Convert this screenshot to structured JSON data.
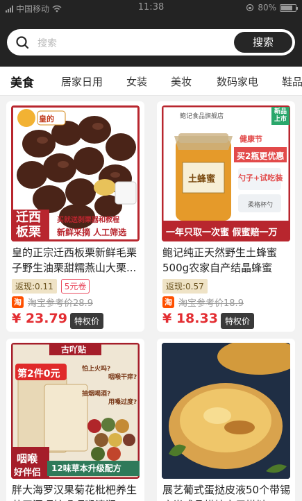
{
  "status": {
    "carrier": "中国移动",
    "time": "11:38",
    "battery": "80%",
    "battery_level": 0.8
  },
  "search": {
    "placeholder": "搜索",
    "button": "搜索"
  },
  "tabs": [
    "美食",
    "居家日用",
    "女装",
    "美妆",
    "数码家电",
    "鞋品"
  ],
  "products": [
    {
      "title": "皇的正宗迁西板栗新鲜毛栗子野生油栗甜糯燕山大栗...",
      "rebate": "返现:0.11",
      "coupon": "5元卷",
      "ref_label": "淘宝参考价",
      "ref_price": "28.9",
      "price": "¥ 23.79",
      "priv": "特权价",
      "img": {
        "brand": "皇的",
        "side_line1": "迁西",
        "side_line2": "板栗",
        "banner1": "买就送剥栗器和教程",
        "banner2": "新鲜采摘 人工筛选"
      }
    },
    {
      "title": "鲍记纯正天然野生土蜂蜜500g农家自产结晶蜂蜜椴...",
      "rebate": "返现:0.57",
      "coupon": "",
      "ref_label": "淘宝参考价",
      "ref_price": "18.9",
      "price": "¥ 18.33",
      "priv": "特权价",
      "img": {
        "store": "鲍记食品旗舰店",
        "new_badge": "新品上市",
        "jar_label": "土蜂蜜",
        "health": "健康节",
        "promo1": "买2瓶更优惠",
        "promo2": "勺子+试吃装",
        "spoon": "柔格杯勺",
        "bottom": "一年只取一次蜜 假蜜赔一万"
      }
    },
    {
      "title": "胖大海罗汉果菊花枇杷养生茶干涸咽护嗓咽喉清润...",
      "img": {
        "brand": "古吖贴",
        "offer": "第2件0元",
        "q1": "怕上火吗?",
        "q2": "咽喉干痒?",
        "q3": "抽烟喝酒?",
        "q4": "用嗓过度?",
        "left1": "咽喉",
        "left2": "好伴侣",
        "bottom": "12味草本升级配方"
      }
    },
    {
      "title": "展艺葡式蛋挞皮液50个带锡底半成品烘焙家用搭挞..."
    }
  ]
}
